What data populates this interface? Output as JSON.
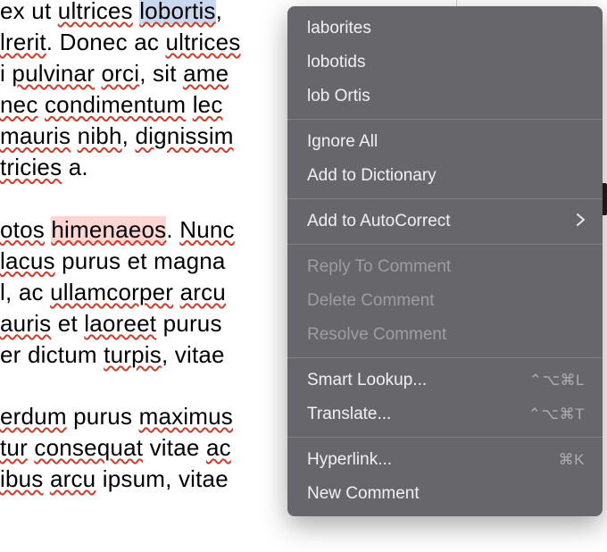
{
  "document": {
    "lines": {
      "l1a": "ex ut ",
      "l1b": "ultrices",
      "l1c": " ",
      "l1d": "lobortis",
      "l1e": ",",
      "l2a": "lrerit",
      "l2b": ". Donec ac ",
      "l2c": "ultrices",
      "l3a": "i ",
      "l3b": "pulvinar",
      "l3c": " ",
      "l3d": "orci",
      "l3e": ", sit ",
      "l3f": "ame",
      "l4a": " ",
      "l4b": "nec",
      "l4c": " ",
      "l4d": "condimentum",
      "l4e": " ",
      "l4f": "lec",
      "l5a": "mauris",
      "l5b": " ",
      "l5c": "nibh",
      "l5d": ", ",
      "l5e": "dignissim",
      "l6a": "tricies",
      "l6b": " a.",
      "l7a": "otos",
      "l7b": " ",
      "l7c": "himenaeos",
      "l7d": ". ",
      "l7e": "Nunc",
      "l8a": " ",
      "l8b": "lacus",
      "l8c": " purus et magna",
      "l9a": "l, ac ",
      "l9b": "ullamcorper",
      "l9c": " ",
      "l9d": "arcu",
      "l10a": "auris",
      "l10b": " et ",
      "l10c": "laoreet",
      "l10d": " purus",
      "l11a": "er dictum ",
      "l11b": "turpis",
      "l11c": ", vitae",
      "l12a": "erdum",
      "l12b": " purus ",
      "l12c": "maximus",
      "l13a": "tur",
      "l13b": " ",
      "l13c": "consequat",
      "l13d": " vitae ",
      "l13e": "ac",
      "l14a": "ibus",
      "l14b": " ",
      "l14c": "arcu",
      "l14d": " ipsum, vitae"
    }
  },
  "menu": {
    "suggestions": [
      {
        "label": "laborites"
      },
      {
        "label": "lobotids"
      },
      {
        "label": "lob Ortis"
      }
    ],
    "ignore_all": "Ignore All",
    "add_to_dictionary": "Add to Dictionary",
    "add_to_autocorrect": "Add to AutoCorrect",
    "reply_to_comment": "Reply To Comment",
    "delete_comment": "Delete Comment",
    "resolve_comment": "Resolve Comment",
    "smart_lookup": "Smart Lookup...",
    "smart_lookup_shortcut": "⌃⌥⌘L",
    "translate": "Translate...",
    "translate_shortcut": "⌃⌥⌘T",
    "hyperlink": "Hyperlink...",
    "hyperlink_shortcut": "⌘K",
    "new_comment": "New Comment"
  }
}
